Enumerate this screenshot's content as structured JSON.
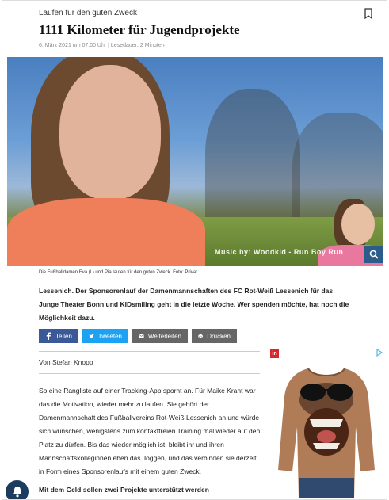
{
  "article": {
    "kicker": "Laufen für den guten Zweck",
    "title": "1111 Kilometer für Jugendprojekte",
    "meta": "6. März 2021 um 07:00 Uhr | Lesedauer: 2 Minuten",
    "image_watermark": "Music by: Woodkid - Run Boy Run",
    "caption": "Die Fußballdamen Eva (l.) und Pia laufen für den guten Zweck. Foto: Privat",
    "lead": "Lessenich. Der Sponsorenlauf der Damenmannschaften des FC Rot-Weiß Lessenich für das Junge Theater Bonn und KIDsmiling geht in die letzte Woche. Wer spenden möchte, hat noch die Möglichkeit dazu.",
    "author": "Von Stefan Knopp",
    "body": "So eine Rangliste auf einer Tracking-App spornt an. Für Maike Krant war das die Motivation, wieder mehr zu laufen. Sie gehört der Damenmannschaft des Fußballvereins Rot-Weiß Lessenich an und würde sich wünschen, wenigstens zum kontaktfreien Training mal wieder auf den Platz zu dürfen. Bis das wieder möglich ist, bleibt ihr und ihren Mannschaftskolleginnen eben das Joggen, und das verbinden sie derzeit in Form eines Sponsorenlaufs mit einem guten Zweck.",
    "subhead": "Mit dem Geld sollen zwei Projekte unterstützt werden"
  },
  "share": {
    "facebook": "Teilen",
    "twitter": "Tweeten",
    "forward": "Weiterleiten",
    "print": "Drucken"
  },
  "ad": {
    "badge": "in"
  },
  "colors": {
    "facebook": "#3b5998",
    "twitter": "#1da1f2",
    "gray_button": "#666666",
    "zoom_button": "#2b5c8a",
    "notify_button": "#1c3c5f"
  },
  "icons": [
    "bookmark-icon",
    "magnifier-icon",
    "facebook-icon",
    "twitter-icon",
    "mail-icon",
    "printer-icon",
    "bell-icon"
  ]
}
